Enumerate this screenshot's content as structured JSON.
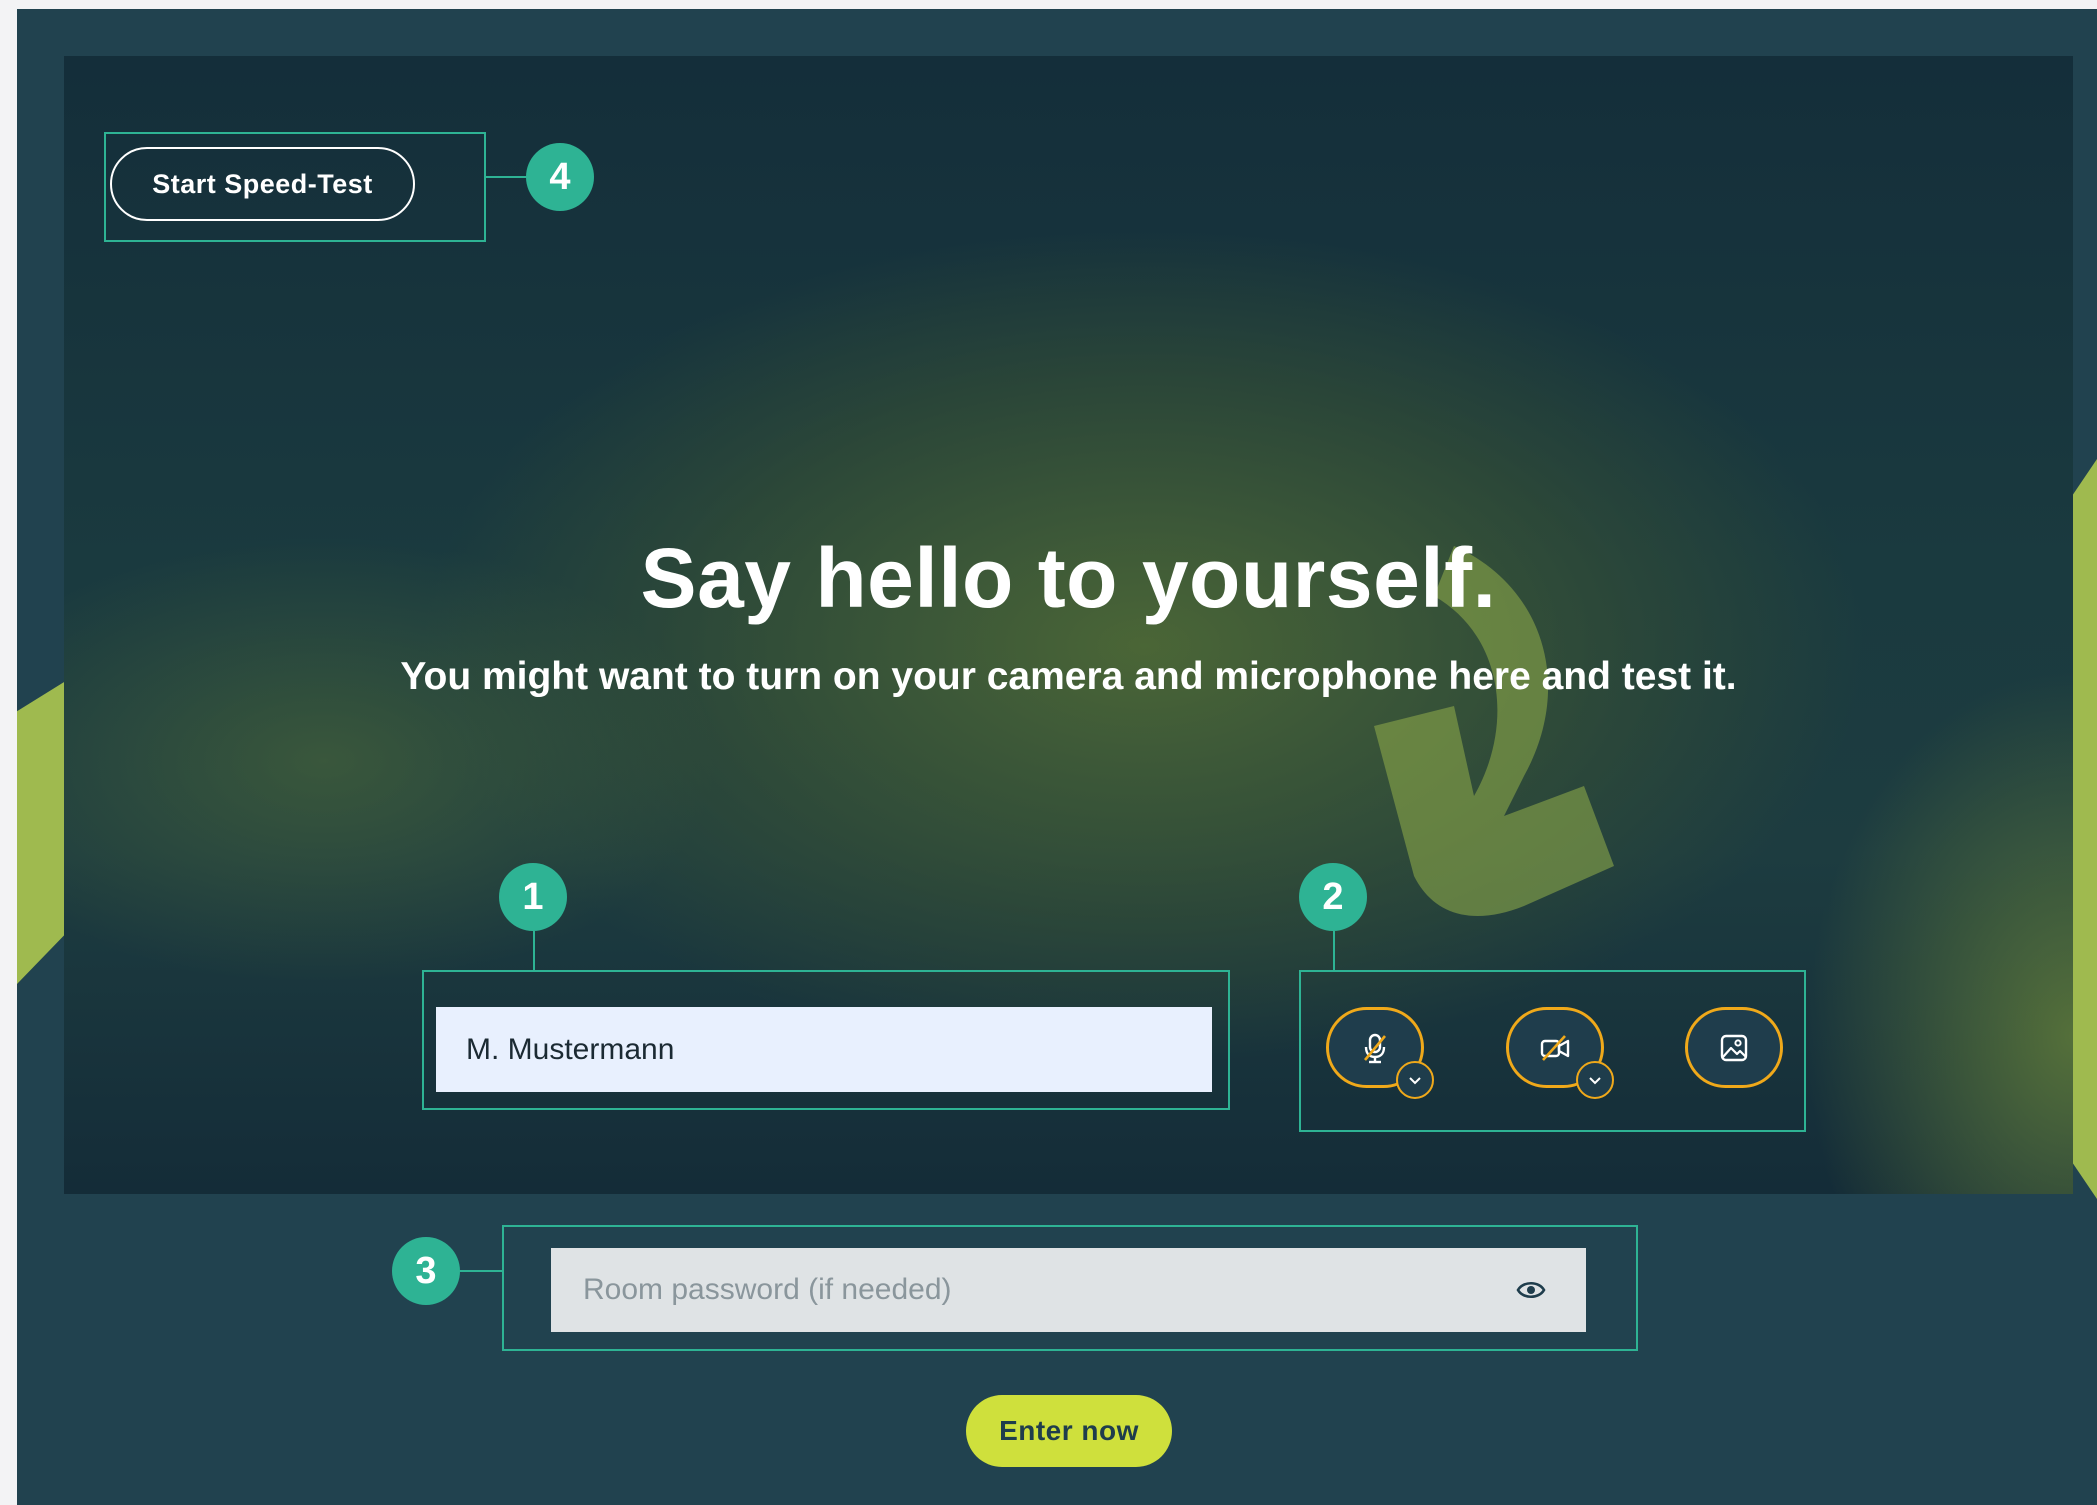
{
  "speedtest": {
    "label": "Start Speed-Test"
  },
  "hero": {
    "title": "Say hello to yourself.",
    "subtitle": "You might want to turn on your camera and microphone here and test it."
  },
  "name_field": {
    "value": "M. Mustermann"
  },
  "media_controls": [
    {
      "icon": "microphone-off-icon",
      "has_dropdown": true
    },
    {
      "icon": "camera-off-icon",
      "has_dropdown": true
    },
    {
      "icon": "background-image-icon",
      "has_dropdown": false
    }
  ],
  "password_field": {
    "placeholder": "Room password (if needed)",
    "value": ""
  },
  "enter_button": {
    "label": "Enter now"
  },
  "annotations": {
    "badge_1": "1",
    "badge_2": "2",
    "badge_3": "3",
    "badge_4": "4"
  },
  "colors": {
    "frame": "#21424f",
    "annotation": "#2eb394",
    "accent_orange": "#f0a91a",
    "enter_button": "#cfe03c",
    "decor_green": "#9fba4f"
  }
}
